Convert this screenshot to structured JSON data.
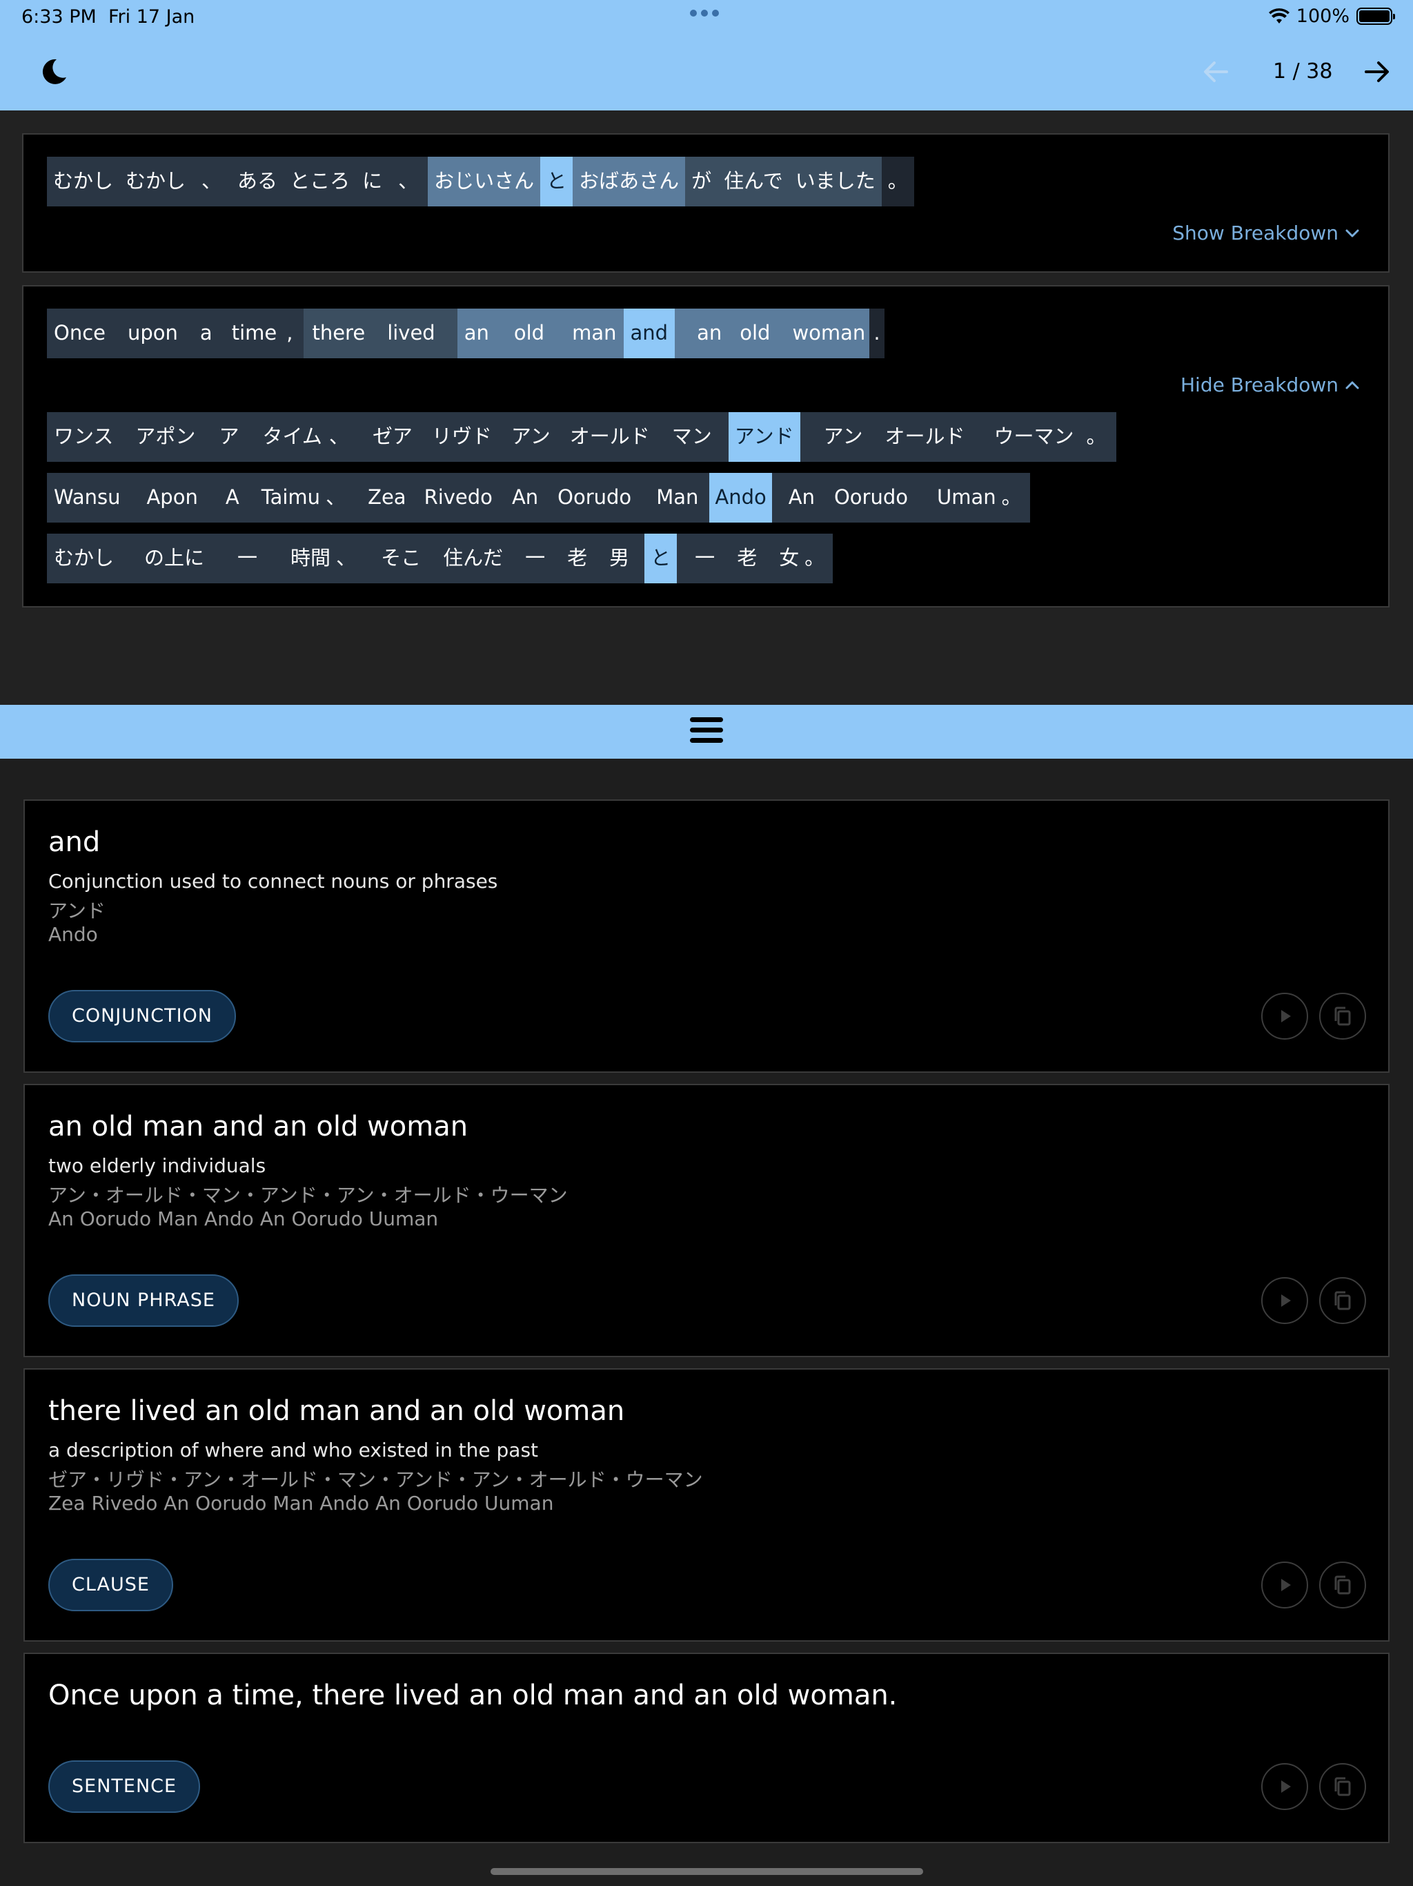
{
  "status": {
    "time": "6:33 PM",
    "date": "Fri 17 Jan",
    "battery": "100%"
  },
  "nav": {
    "page": "1 / 38"
  },
  "japanese": {
    "tokens": [
      "むかし",
      "むかし",
      "、",
      "ある",
      "ところ",
      "に",
      "、",
      "おじいさん",
      "と",
      "おばあさん",
      "が",
      "住んで",
      "いました",
      "。"
    ],
    "toggle_label": "Show Breakdown"
  },
  "english": {
    "tokens": [
      "Once",
      "upon",
      "a",
      "time",
      ",",
      "there",
      "lived",
      "an",
      "old",
      "man",
      "and",
      "an",
      "old",
      "woman",
      "."
    ],
    "toggle_label": "Hide Breakdown",
    "katakana": [
      "ワンス",
      "アポン",
      "ア",
      "タイム",
      "、",
      "ゼア",
      "リヴド",
      "アン",
      "オールド",
      "マン",
      "アンド",
      "アン",
      "オールド",
      "ウーマン",
      "。"
    ],
    "romaji": [
      "Wansu",
      "Apon",
      "A",
      "Taimu",
      "、",
      "Zea",
      "Rivedo",
      "An",
      "Oorudo",
      "Man",
      "Ando",
      "An",
      "Oorudo",
      "Uman",
      "。"
    ],
    "gloss": [
      "むかし",
      "の上に",
      "一",
      "時間",
      "、",
      "そこ",
      "住んだ",
      "一",
      "老",
      "男",
      "と",
      "一",
      "老",
      "女",
      "。"
    ]
  },
  "cards": [
    {
      "title": "and",
      "definition": "Conjunction used to connect nouns or phrases",
      "kana": "アンド",
      "romaji": "Ando",
      "tag": "CONJUNCTION"
    },
    {
      "title": "an old man and an old woman",
      "definition": "two elderly individuals",
      "kana": "アン・オールド・マン・アンド・アン・オールド・ウーマン",
      "romaji": "An Oorudo Man Ando An Oorudo Uuman",
      "tag": "NOUN PHRASE"
    },
    {
      "title": "there lived an old man and an old woman",
      "definition": "a description of where and who existed in the past",
      "kana": "ゼア・リヴド・アン・オールド・マン・アンド・アン・オールド・ウーマン",
      "romaji": "Zea Rivedo An Oorudo Man Ando An Oorudo Uuman",
      "tag": "CLAUSE"
    },
    {
      "title": "Once upon a time, there lived an old man and an old woman.",
      "tag": "SENTENCE"
    }
  ],
  "colors": {
    "accent": "#90c8f8",
    "highlight": "#8fc8f7",
    "phrase": "#5b7c9c",
    "token_bg": "#2a3644",
    "tag_bg": "#0f2d4a"
  },
  "icons": [
    "moon-icon",
    "arrow-left-icon",
    "arrow-right-icon",
    "chevron-down-icon",
    "chevron-up-icon",
    "hamburger-icon",
    "play-icon",
    "copy-icon",
    "wifi-icon",
    "battery-icon"
  ]
}
